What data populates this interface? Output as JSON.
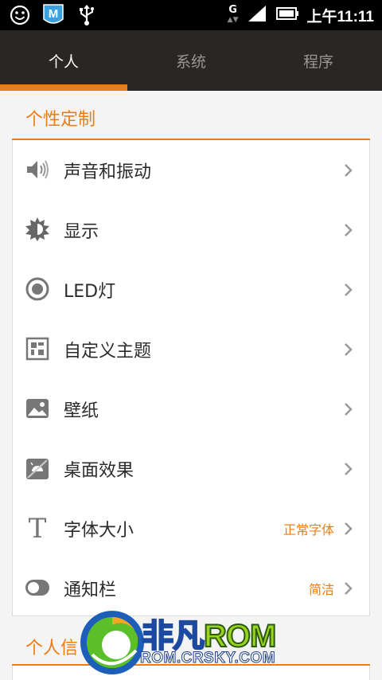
{
  "status_bar": {
    "network": "G",
    "time": "上午11:11",
    "icons": [
      "smiley-icon",
      "m-app-icon",
      "usb-icon",
      "signal-icon",
      "battery-icon"
    ]
  },
  "tabs": [
    {
      "label": "个人",
      "active": true
    },
    {
      "label": "系统",
      "active": false
    },
    {
      "label": "程序",
      "active": false
    }
  ],
  "section_personalize": {
    "title": "个性定制",
    "items": [
      {
        "label": "声音和振动",
        "icon": "speaker-icon",
        "value": ""
      },
      {
        "label": "显示",
        "icon": "brightness-icon",
        "value": ""
      },
      {
        "label": "LED灯",
        "icon": "led-icon",
        "value": ""
      },
      {
        "label": "自定义主题",
        "icon": "theme-icon",
        "value": ""
      },
      {
        "label": "壁纸",
        "icon": "wallpaper-icon",
        "value": ""
      },
      {
        "label": "桌面效果",
        "icon": "desktop-effect-icon",
        "value": ""
      },
      {
        "label": "字体大小",
        "icon": "font-icon",
        "value": "正常字体"
      },
      {
        "label": "通知栏",
        "icon": "toggle-icon",
        "value": "简洁"
      }
    ]
  },
  "section_personal_info": {
    "title": "个人信"
  },
  "watermark": {
    "brand_cn": "非凡",
    "brand_rom": "ROM",
    "url": "ROM.CRSKY.COM"
  },
  "colors": {
    "accent": "#ec7d14",
    "tab_bar": "#2a2624",
    "background": "#f4f4f4"
  }
}
